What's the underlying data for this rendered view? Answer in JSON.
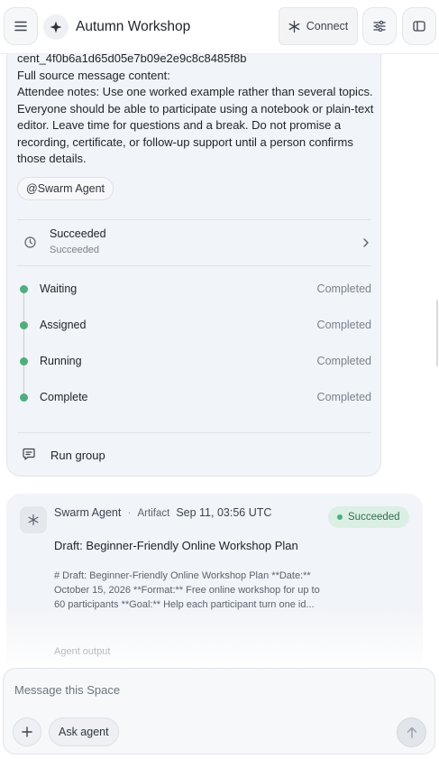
{
  "header": {
    "title": "Autumn Workshop",
    "connect_label": "Connect"
  },
  "message": {
    "id_line": "cent_4f0b6a1d65d05e7b09e2e9c8c8485f8b",
    "source_label": "Full source message content:",
    "body": "Attendee notes: Use one worked example rather than several topics. Everyone should be able to participate using a notebook or plain-text editor. Leave time for questions and a break. Do not promise a recording, certificate, or follow-up support until a person confirms those details.",
    "mention": "@Swarm Agent"
  },
  "run": {
    "status_title": "Succeeded",
    "status_subtitle": "Succeeded",
    "steps": [
      {
        "label": "Waiting",
        "state": "Completed"
      },
      {
        "label": "Assigned",
        "state": "Completed"
      },
      {
        "label": "Running",
        "state": "Completed"
      },
      {
        "label": "Complete",
        "state": "Completed"
      }
    ],
    "group_label": "Run group"
  },
  "artifact": {
    "agent": "Swarm Agent",
    "separator": "·",
    "kind": "Artifact",
    "timestamp": "Sep 11, 03:56 UTC",
    "status": "Succeeded",
    "title": "Draft: Beginner-Friendly Online Workshop Plan",
    "snippet": "# Draft: Beginner-Friendly Online Workshop Plan **Date:** October 15, 2026 **Format:** Free online workshop for up to 60 participants **Goal:** Help each participant turn one id...",
    "more_label": "Agent output"
  },
  "composer": {
    "placeholder": "Message this Space",
    "ask_label": "Ask agent"
  },
  "colors": {
    "success": "#4fae7d",
    "card_bg": "#f1f4f8"
  }
}
